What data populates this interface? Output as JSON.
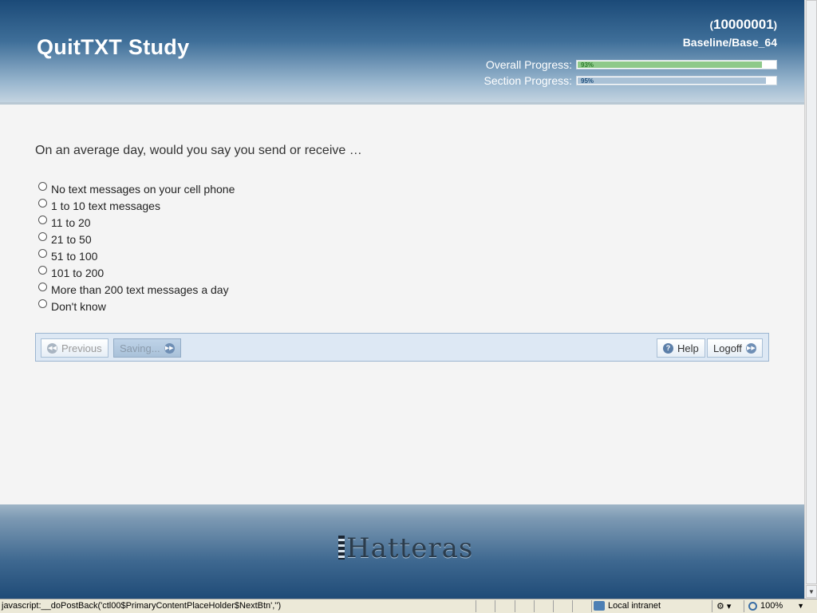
{
  "header": {
    "title": "QuitTXT Study",
    "participant_open": "(",
    "participant_id": "10000001",
    "participant_close": ")",
    "survey_code": "Baseline/Base_64",
    "overall_label": "Overall Progress:",
    "overall_pct_text": "93%",
    "overall_value": 0.93,
    "section_label": "Section Progress:",
    "section_pct_text": "95%",
    "section_value": 0.95
  },
  "question": {
    "text": "On an average day, would you say you send or receive …",
    "options": [
      "No text messages on your cell phone",
      "1 to 10 text messages",
      "11 to 20",
      "21 to 50",
      "51 to 100",
      "101 to 200",
      "More than 200 text messages a day",
      "Don't know"
    ]
  },
  "nav": {
    "previous_label": "Previous",
    "next_label": "Saving...",
    "help_label": "Help",
    "logoff_label": "Logoff"
  },
  "footer": {
    "logo_text": "Hatteras"
  },
  "statusbar": {
    "status_text": "javascript:__doPostBack('ctl00$PrimaryContentPlaceHolder$NextBtn','')",
    "zone_label": "Local intranet",
    "zoom_label": "100%"
  },
  "colors": {
    "header_top": "#1b4a78",
    "progress_green": "#8ec98a",
    "progress_blue": "#a9c1d6",
    "nav_bar_bg": "#dde8f4"
  }
}
